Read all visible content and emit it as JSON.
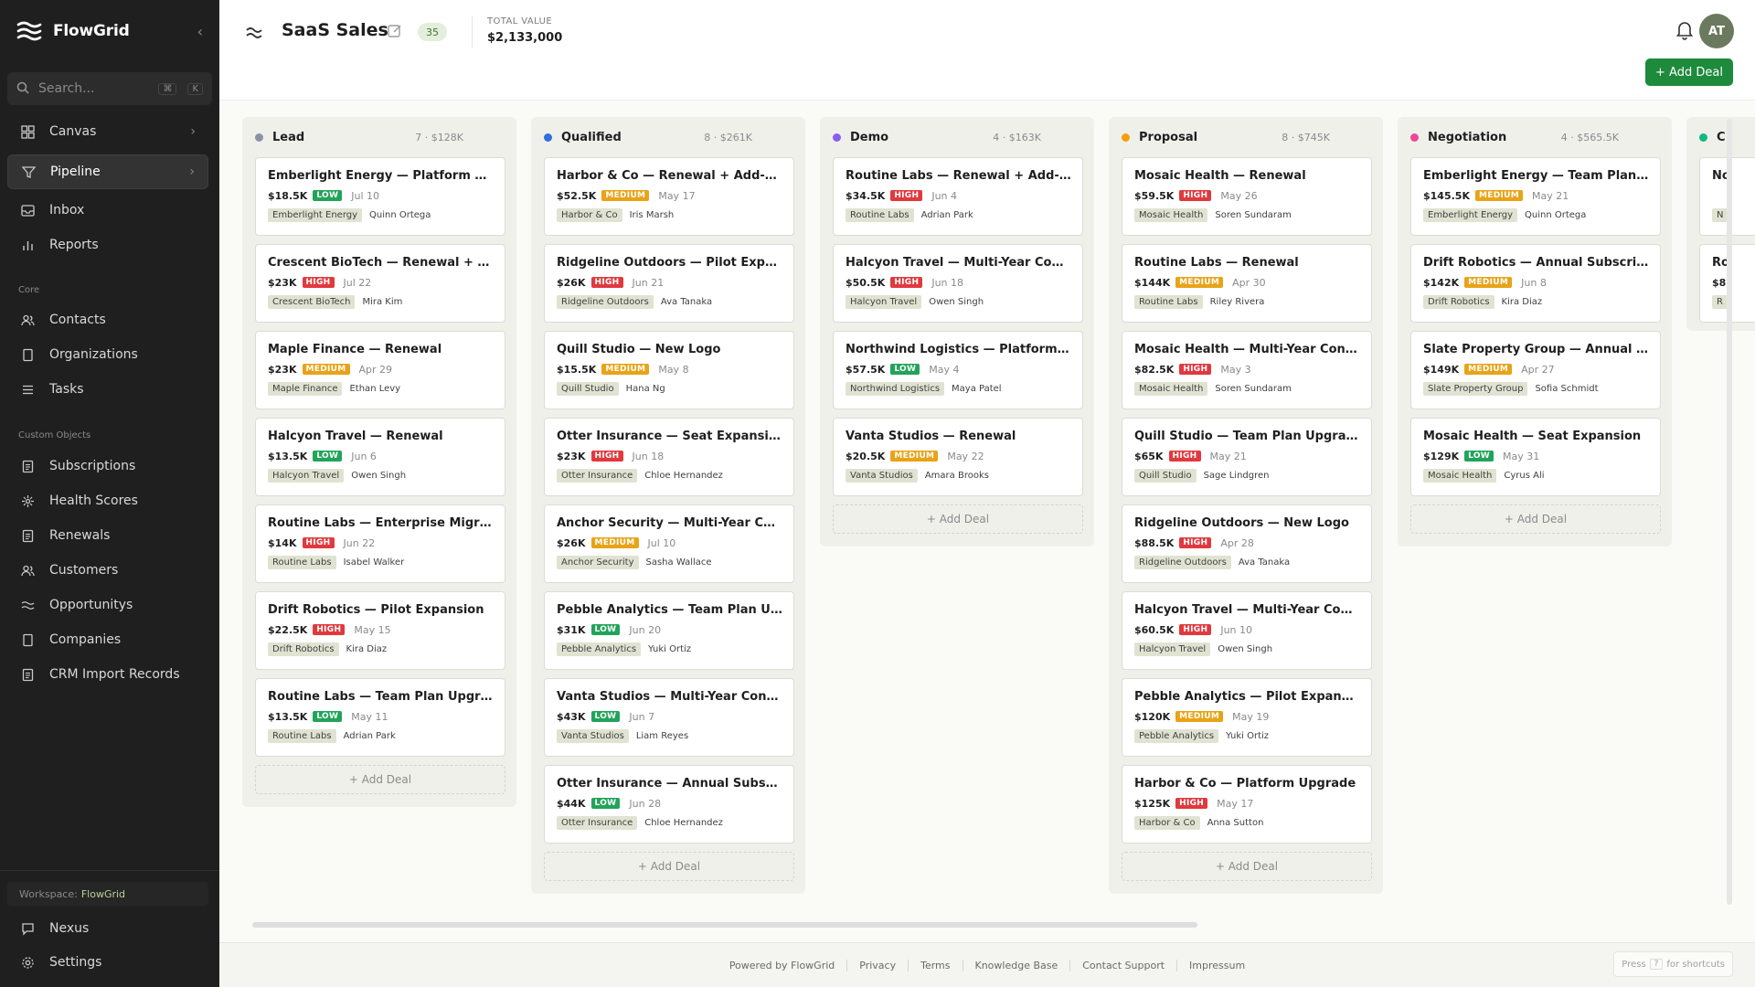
{
  "app": {
    "name": "FlowGrid"
  },
  "sidebar": {
    "search_placeholder": "Search...",
    "search_keys": [
      "⌘",
      "K"
    ],
    "main_items": [
      {
        "label": "Canvas",
        "icon": "grid-icon",
        "chevron": true,
        "active": false
      },
      {
        "label": "Pipeline",
        "icon": "filter-icon",
        "chevron": true,
        "active": true
      },
      {
        "label": "Inbox",
        "icon": "inbox-icon",
        "chevron": false,
        "active": false
      },
      {
        "label": "Reports",
        "icon": "bar-chart-icon",
        "chevron": false,
        "active": false
      }
    ],
    "core_label": "Core",
    "core_items": [
      {
        "label": "Contacts",
        "icon": "users-icon"
      },
      {
        "label": "Organizations",
        "icon": "document-icon"
      },
      {
        "label": "Tasks",
        "icon": "list-icon"
      }
    ],
    "custom_label": "Custom Objects",
    "custom_items": [
      {
        "label": "Subscriptions",
        "icon": "file-text-icon"
      },
      {
        "label": "Health Scores",
        "icon": "pulse-icon"
      },
      {
        "label": "Renewals",
        "icon": "file-text-icon"
      },
      {
        "label": "Customers",
        "icon": "users-icon"
      },
      {
        "label": "Opportunitys",
        "icon": "waves-icon"
      },
      {
        "label": "Companies",
        "icon": "document-icon"
      },
      {
        "label": "CRM Import Records",
        "icon": "file-text-icon"
      }
    ],
    "workspace_label": "Workspace:",
    "workspace_name": "FlowGrid",
    "bottom_items": [
      {
        "label": "Nexus",
        "icon": "chat-icon"
      },
      {
        "label": "Settings",
        "icon": "gear-icon"
      }
    ]
  },
  "header": {
    "title": "SaaS Sales",
    "count": "35",
    "total_label": "TOTAL VALUE",
    "total_value": "$2,133,000",
    "avatar_initials": "AT",
    "add_deal": "+ Add Deal"
  },
  "priority_colors": {
    "HIGH": "#e0393e",
    "MEDIUM": "#e8a317",
    "LOW": "#22a35a"
  },
  "add_deal_label": "+ Add Deal",
  "columns": [
    {
      "name": "Lead",
      "color": "#8a93a6",
      "count": "7",
      "value": "$128K",
      "deals": [
        {
          "title": "Emberlight Energy — Platform Upgrade",
          "amount": "$18.5K",
          "priority": "LOW",
          "date": "Jul 10",
          "org": "Emberlight Energy",
          "owner": "Quinn Ortega"
        },
        {
          "title": "Crescent BioTech — Renewal + Add-On",
          "amount": "$23K",
          "priority": "HIGH",
          "date": "Jul 22",
          "org": "Crescent BioTech",
          "owner": "Mira Kim"
        },
        {
          "title": "Maple Finance — Renewal",
          "amount": "$23K",
          "priority": "MEDIUM",
          "date": "Apr 29",
          "org": "Maple Finance",
          "owner": "Ethan Levy"
        },
        {
          "title": "Halcyon Travel — Renewal",
          "amount": "$13.5K",
          "priority": "LOW",
          "date": "Jun 6",
          "org": "Halcyon Travel",
          "owner": "Owen Singh"
        },
        {
          "title": "Routine Labs — Enterprise Migration",
          "amount": "$14K",
          "priority": "HIGH",
          "date": "Jun 22",
          "org": "Routine Labs",
          "owner": "Isabel Walker"
        },
        {
          "title": "Drift Robotics — Pilot Expansion",
          "amount": "$22.5K",
          "priority": "HIGH",
          "date": "May 15",
          "org": "Drift Robotics",
          "owner": "Kira Diaz"
        },
        {
          "title": "Routine Labs — Team Plan Upgrade",
          "amount": "$13.5K",
          "priority": "LOW",
          "date": "May 11",
          "org": "Routine Labs",
          "owner": "Adrian Park"
        }
      ]
    },
    {
      "name": "Qualified",
      "color": "#2f6fde",
      "count": "8",
      "value": "$261K",
      "deals": [
        {
          "title": "Harbor & Co — Renewal + Add-On",
          "amount": "$52.5K",
          "priority": "MEDIUM",
          "date": "May 17",
          "org": "Harbor & Co",
          "owner": "Iris Marsh"
        },
        {
          "title": "Ridgeline Outdoors — Pilot Expansion",
          "amount": "$26K",
          "priority": "HIGH",
          "date": "Jun 21",
          "org": "Ridgeline Outdoors",
          "owner": "Ava Tanaka"
        },
        {
          "title": "Quill Studio — New Logo",
          "amount": "$15.5K",
          "priority": "MEDIUM",
          "date": "May 8",
          "org": "Quill Studio",
          "owner": "Hana Ng"
        },
        {
          "title": "Otter Insurance — Seat Expansion",
          "amount": "$23K",
          "priority": "HIGH",
          "date": "Jun 18",
          "org": "Otter Insurance",
          "owner": "Chloe Hernandez"
        },
        {
          "title": "Anchor Security — Multi-Year Contract",
          "amount": "$26K",
          "priority": "MEDIUM",
          "date": "Jul 10",
          "org": "Anchor Security",
          "owner": "Sasha Wallace"
        },
        {
          "title": "Pebble Analytics — Team Plan Upgrade",
          "amount": "$31K",
          "priority": "LOW",
          "date": "Jun 20",
          "org": "Pebble Analytics",
          "owner": "Yuki Ortiz"
        },
        {
          "title": "Vanta Studios — Multi-Year Contract",
          "amount": "$43K",
          "priority": "LOW",
          "date": "Jun 7",
          "org": "Vanta Studios",
          "owner": "Liam Reyes"
        },
        {
          "title": "Otter Insurance — Annual Subscription",
          "amount": "$44K",
          "priority": "LOW",
          "date": "Jun 28",
          "org": "Otter Insurance",
          "owner": "Chloe Hernandez"
        }
      ]
    },
    {
      "name": "Demo",
      "color": "#8b5cf6",
      "count": "4",
      "value": "$163K",
      "deals": [
        {
          "title": "Routine Labs — Renewal + Add-On",
          "amount": "$34.5K",
          "priority": "HIGH",
          "date": "Jun 4",
          "org": "Routine Labs",
          "owner": "Adrian Park"
        },
        {
          "title": "Halcyon Travel — Multi-Year Contract",
          "amount": "$50.5K",
          "priority": "HIGH",
          "date": "Jun 18",
          "org": "Halcyon Travel",
          "owner": "Owen Singh"
        },
        {
          "title": "Northwind Logistics — Platform Upgrade",
          "amount": "$57.5K",
          "priority": "LOW",
          "date": "May 4",
          "org": "Northwind Logistics",
          "owner": "Maya Patel"
        },
        {
          "title": "Vanta Studios — Renewal",
          "amount": "$20.5K",
          "priority": "MEDIUM",
          "date": "May 22",
          "org": "Vanta Studios",
          "owner": "Amara Brooks"
        }
      ]
    },
    {
      "name": "Proposal",
      "color": "#f59e0b",
      "count": "8",
      "value": "$745K",
      "deals": [
        {
          "title": "Mosaic Health — Renewal",
          "amount": "$59.5K",
          "priority": "HIGH",
          "date": "May 26",
          "org": "Mosaic Health",
          "owner": "Soren Sundaram"
        },
        {
          "title": "Routine Labs — Renewal",
          "amount": "$144K",
          "priority": "MEDIUM",
          "date": "Apr 30",
          "org": "Routine Labs",
          "owner": "Riley Rivera"
        },
        {
          "title": "Mosaic Health — Multi-Year Contract",
          "amount": "$82.5K",
          "priority": "HIGH",
          "date": "May 3",
          "org": "Mosaic Health",
          "owner": "Soren Sundaram"
        },
        {
          "title": "Quill Studio — Team Plan Upgrade",
          "amount": "$65K",
          "priority": "HIGH",
          "date": "May 21",
          "org": "Quill Studio",
          "owner": "Sage Lindgren"
        },
        {
          "title": "Ridgeline Outdoors — New Logo",
          "amount": "$88.5K",
          "priority": "HIGH",
          "date": "Apr 28",
          "org": "Ridgeline Outdoors",
          "owner": "Ava Tanaka"
        },
        {
          "title": "Halcyon Travel — Multi-Year Contract",
          "amount": "$60.5K",
          "priority": "HIGH",
          "date": "Jun 10",
          "org": "Halcyon Travel",
          "owner": "Owen Singh"
        },
        {
          "title": "Pebble Analytics — Pilot Expansion",
          "amount": "$120K",
          "priority": "MEDIUM",
          "date": "May 19",
          "org": "Pebble Analytics",
          "owner": "Yuki Ortiz"
        },
        {
          "title": "Harbor & Co — Platform Upgrade",
          "amount": "$125K",
          "priority": "HIGH",
          "date": "May 17",
          "org": "Harbor & Co",
          "owner": "Anna Sutton"
        }
      ]
    },
    {
      "name": "Negotiation",
      "color": "#ec4899",
      "count": "4",
      "value": "$565.5K",
      "deals": [
        {
          "title": "Emberlight Energy — Team Plan Upgrade",
          "amount": "$145.5K",
          "priority": "MEDIUM",
          "date": "May 21",
          "org": "Emberlight Energy",
          "owner": "Quinn Ortega"
        },
        {
          "title": "Drift Robotics — Annual Subscription",
          "amount": "$142K",
          "priority": "MEDIUM",
          "date": "Jun 8",
          "org": "Drift Robotics",
          "owner": "Kira Diaz"
        },
        {
          "title": "Slate Property Group — Annual Subscription",
          "amount": "$149K",
          "priority": "MEDIUM",
          "date": "Apr 27",
          "org": "Slate Property Group",
          "owner": "Sofia Schmidt"
        },
        {
          "title": "Mosaic Health — Seat Expansion",
          "amount": "$129K",
          "priority": "LOW",
          "date": "May 31",
          "org": "Mosaic Health",
          "owner": "Cyrus Ali"
        }
      ]
    },
    {
      "name": "C",
      "color": "#10b981",
      "count": "",
      "value": "",
      "deals": [
        {
          "title": "No",
          "amount": "",
          "priority": "",
          "date": "",
          "org": "N",
          "owner": ""
        },
        {
          "title": "Ro",
          "amount": "$8",
          "priority": "",
          "date": "",
          "org": "R",
          "owner": ""
        }
      ]
    }
  ],
  "footer": {
    "links": [
      "Powered by FlowGrid",
      "Privacy",
      "Terms",
      "Knowledge Base",
      "Contact Support",
      "Impressum"
    ],
    "hint_press": "Press",
    "hint_key": "?",
    "hint_rest": "for shortcuts"
  }
}
